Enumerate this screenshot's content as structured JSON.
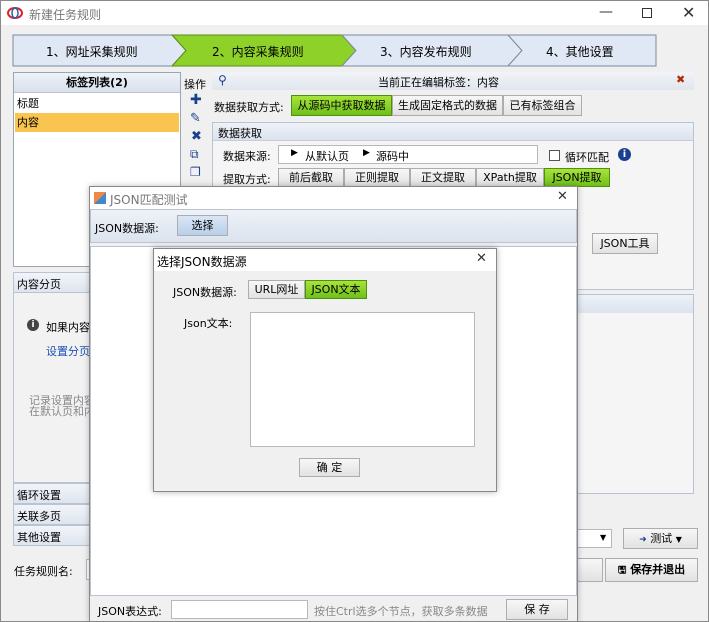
{
  "window": {
    "title": "新建任务规则"
  },
  "steps": [
    "1、网址采集规则",
    "2、内容采集规则",
    "3、内容发布规则",
    "4、其他设置"
  ],
  "taglist": {
    "title": "标签列表(2)",
    "items": [
      "标题",
      "内容"
    ],
    "ops_label": "操作"
  },
  "editing": {
    "text": "当前正在编辑标签：内容"
  },
  "extract": {
    "method_label": "数据获取方式:",
    "tabs": [
      "从源码中获取数据",
      "生成固定格式的数据",
      "已有标签组合"
    ]
  },
  "data_get": {
    "title": "数据获取",
    "source_label": "数据来源:",
    "source_path": [
      "从默认页",
      "源码中"
    ],
    "loop_label": "循环匹配",
    "method_label": "提取方式:",
    "method_tabs": [
      "前后截取",
      "正则提取",
      "正文提取",
      "XPath提取",
      "JSON提取"
    ],
    "json_tool": "JSON工具"
  },
  "left": {
    "content_paging": "内容分页",
    "paging_hint": "如果内容",
    "paging_link": "设置分页",
    "record_hint1": "记录设置内容",
    "record_hint2": "在默认页和内",
    "loop_settings": "循环设置",
    "related_pages": "关联多页",
    "other_settings": "其他设置"
  },
  "bottom": {
    "task_name_label": "任务规则名:",
    "test_button": "测试",
    "save_exit_button": "保存并退出"
  },
  "json_dialog": {
    "title": "JSON匹配测试",
    "source_label": "JSON数据源:",
    "select_button": "选择",
    "expr_label": "JSON表达式:",
    "expr_hint": "按住Ctrl选多个节点，获取多条数据",
    "save_button": "保 存"
  },
  "source_dialog": {
    "title": "选择JSON数据源",
    "source_label": "JSON数据源:",
    "tabs": [
      "URL网址",
      "JSON文本"
    ],
    "text_label": "Json文本:",
    "ok_button": "确 定"
  },
  "colors": {
    "accent_green": "#7ccc22",
    "selected_row": "#f9c44f",
    "step_active": "#8ed128",
    "step_inactive": "#dfe8f4"
  }
}
